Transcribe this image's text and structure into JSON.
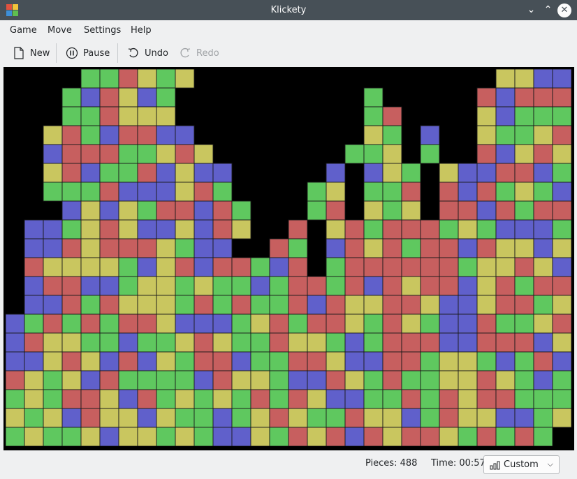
{
  "window": {
    "title": "Klickety"
  },
  "menu": {
    "items": [
      "Game",
      "Move",
      "Settings",
      "Help"
    ]
  },
  "toolbar": {
    "new_label": "New",
    "pause_label": "Pause",
    "undo_label": "Undo",
    "redo_label": "Redo"
  },
  "status": {
    "pieces": "Pieces: 488",
    "time": "Time: 00:57",
    "difficulty": "Custom"
  },
  "colors": {
    "G": "#5fc85f",
    "R": "#c75f5f",
    "B": "#6060cb",
    "Y": "#c9c65f",
    "K": "#000000",
    "accent_titlebar": "#475057"
  },
  "board": {
    "columns": 30,
    "rows": 20,
    "empty_code": "K",
    "grid": [
      "KKKKGGRYGYKKKKKKKKKKKKKKKKYYBB",
      "KKKGBRYBGKKKKKKKKKKGKKKKKRBRRR",
      "KKKGGRYYYKKKKKKKKKKGRKKKKYBGGG",
      "KKYRGBRRBBKKKKKKKKKYGKBKKYGGYR",
      "KKBRRRGGYRYKKKKKKKGGYKGKKRBYRY",
      "KKYRBGGRBYBBKKKKKBKBYGKYBBRRBG",
      "KKGGGRBBBYRGKKKKGYKGGRKRBRGYGB",
      "KKKBYBYGRRBRGKKKGRKYGYKRRBRGRR",
      "KBBGYRYBBYBRYKKRKYRGRRRGYGBBBG",
      "KBBRYRRRYGBBKKRGKBRYRGRRBRYYBY",
      "KRYYYYGBYRBRRGBRKGRRRRRRGYYRYB",
      "KBRRBBGYYGYGGBGRRGRBRYRRBYRGRR",
      "KBBRGRYYYGRGRGGRBRYYRRYBBYRRGY",
      "BGRGRGRRYBBBGYRGRRYGRYGBBRGGYR",
      "BRYYGGBGGYRYGGRYYGBGRRRBBRRRBY",
      "BBYRYBRBYGRRBGGRRYBBRRGYYGBGRB",
      "RYGYBRGGGGBRYYGBBRYGRGGYYRYGBG",
      "GYGRRYBRGYGYGRGRYBBGGRGRYRRGGG",
      "YGYBRYYBYGGBGYRYGGRYYBGRYYBBGY",
      "GYGGYBYYGYGBBYGRYRBRYRRYGRGRG"
    ]
  }
}
